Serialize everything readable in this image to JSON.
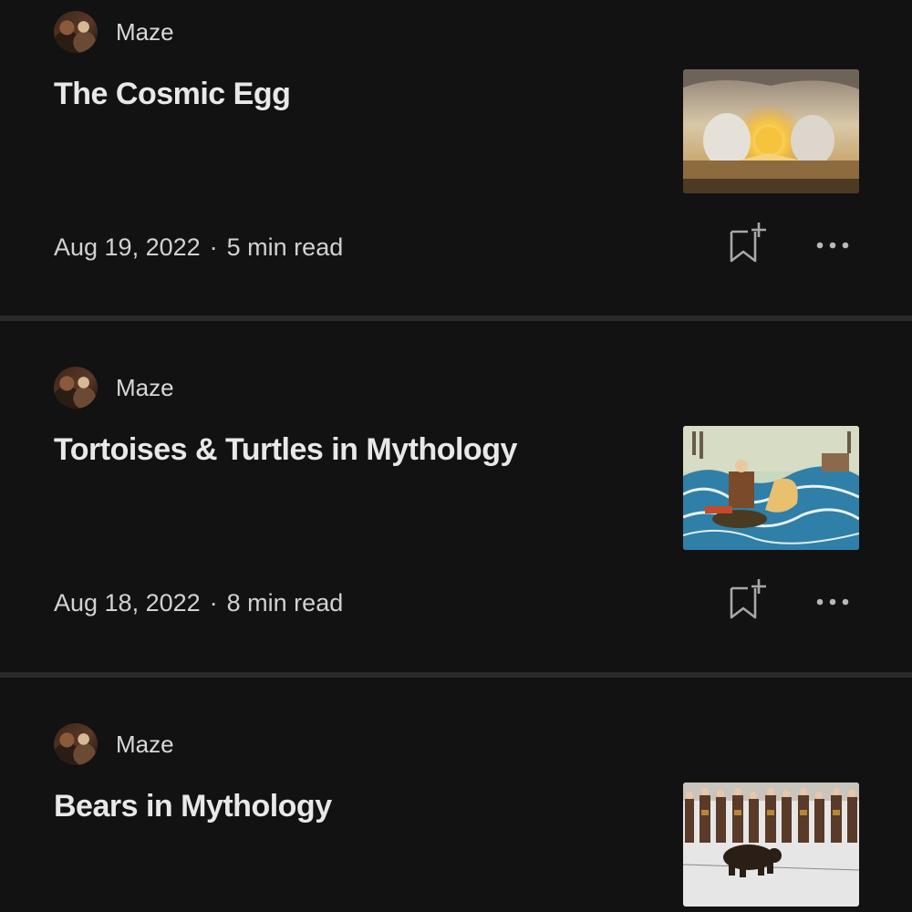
{
  "articles": [
    {
      "author": "Maze",
      "title": "The Cosmic Egg",
      "date": "Aug 19, 2022",
      "separator": "·",
      "read_time": "5 min read"
    },
    {
      "author": "Maze",
      "title": "Tortoises & Turtles in Mythology",
      "date": "Aug 18, 2022",
      "separator": "·",
      "read_time": "8 min read"
    },
    {
      "author": "Maze",
      "title": "Bears in Mythology",
      "date": "",
      "separator": "",
      "read_time": ""
    }
  ],
  "icons": {
    "bookmark": "bookmark-add-icon",
    "more": "more-horizontal-icon"
  },
  "colors": {
    "background": "#121212",
    "divider": "#2a2a2a",
    "title_text": "#e8e8e8",
    "meta_text": "#d2d2d2"
  }
}
